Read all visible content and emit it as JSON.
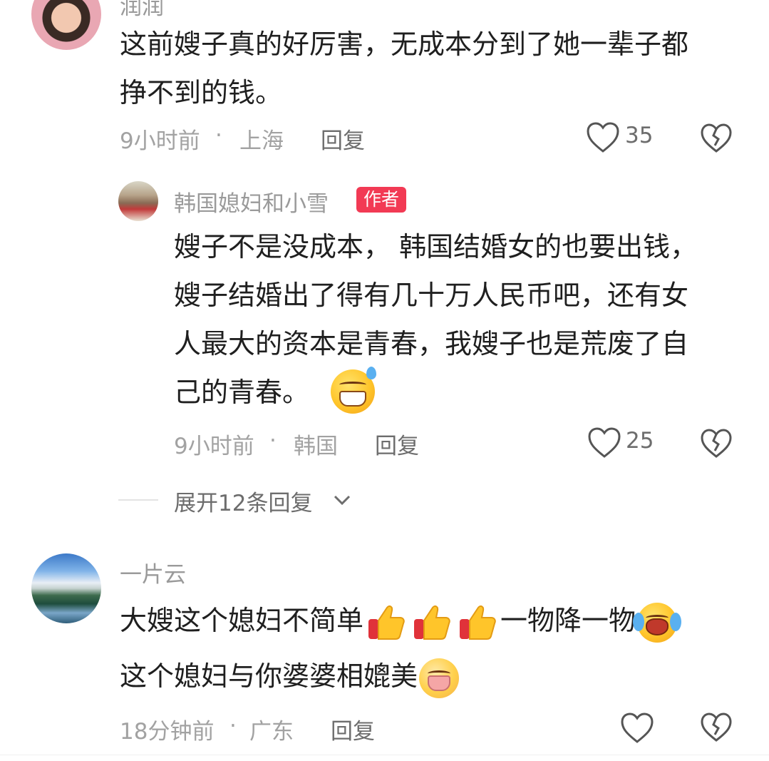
{
  "comments": [
    {
      "name": "润润",
      "text_lines": [
        "这前嫂子真的好厉害，无成本分到了她一辈子都",
        "挣不到的钱。"
      ],
      "time": "9小时前",
      "location": "上海",
      "reply_label": "回复",
      "likes": "35"
    },
    {
      "name": "韩国媳妇和小雪",
      "badge": "作者",
      "text_lines": [
        "嫂子不是没成本， 韩国结婚女的也要出钱，",
        "嫂子结婚出了得有几十万人民币吧，还有女",
        "人最大的资本是青春，我嫂子也是荒废了自",
        "己的青春。"
      ],
      "emoji_after_last_line": "grinning-sweat-emoji",
      "time": "9小时前",
      "location": "韩国",
      "reply_label": "回复",
      "likes": "25",
      "expand_label": "展开12条回复"
    },
    {
      "name": "一片云",
      "text_line1_a": "大嫂这个媳妇不简单",
      "text_line1_b": "一物降一物",
      "text_line2": "这个媳妇与你婆婆相媲美",
      "time": "18分钟前",
      "location": "广东",
      "reply_label": "回复",
      "likes": ""
    }
  ],
  "separator": "·",
  "icons": {
    "like": "heart-icon",
    "dislike": "broken-heart-icon",
    "expand": "chevron-down-icon"
  },
  "colors": {
    "badge": "#f23a54",
    "meta_text": "#a2a2a2",
    "body_text": "#1f1f1f"
  }
}
